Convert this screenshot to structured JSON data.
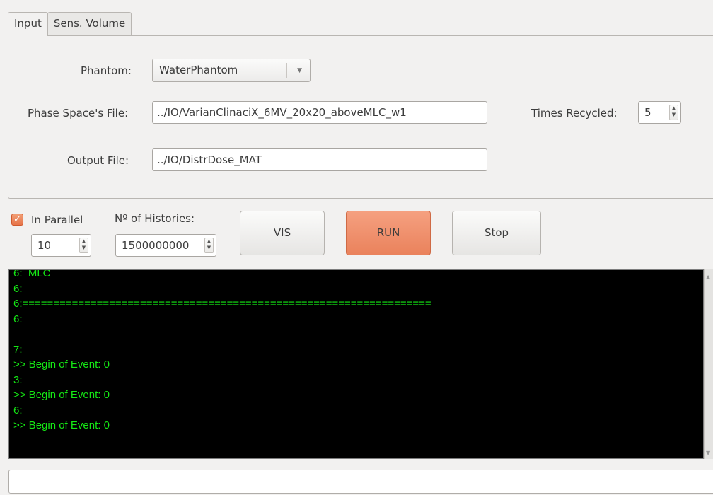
{
  "tabs": [
    {
      "label": "Input",
      "active": true
    },
    {
      "label": "Sens. Volume",
      "active": false
    }
  ],
  "input": {
    "phantom_label": "Phantom:",
    "phantom_value": "WaterPhantom",
    "phase_space_label": "Phase Space's File:",
    "phase_space_value": "../IO/VarianClinaciX_6MV_20x20_aboveMLC_w1",
    "times_recycled_label": "Times Recycled:",
    "times_recycled_value": "5",
    "output_label": "Output File:",
    "output_value": "../IO/DistrDose_MAT"
  },
  "controls": {
    "parallel_label": "In Parallel",
    "parallel_checked": true,
    "parallel_value": "10",
    "histories_label": "Nº of Histories:",
    "histories_value": "1500000000",
    "vis_label": "VIS",
    "run_label": "RUN",
    "stop_label": "Stop"
  },
  "console": {
    "lines": [
      "6:  MLC",
      "6:",
      "6:==================================================================",
      "6:",
      "",
      "7:",
      ">> Begin of Event: 0",
      "3:",
      ">> Begin of Event: 0",
      "6:",
      ">> Begin of Event: 0"
    ]
  },
  "status_field": {
    "value": ""
  },
  "colors": {
    "console_text": "#15e815",
    "console_bg": "#000000",
    "accent": "#ea825c"
  },
  "icons": {
    "combo_arrow": "chevron-down-icon",
    "spin": "up-down-arrows-icon",
    "check": "checkmark-icon"
  }
}
